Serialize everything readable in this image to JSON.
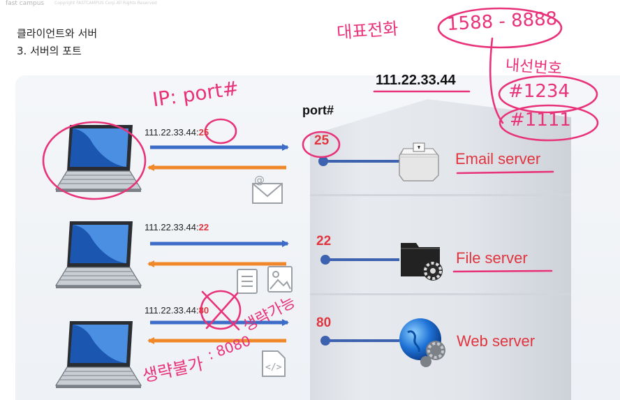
{
  "header": {
    "brand": "fast campus",
    "copyright": "Copyright FASTCAMPUS Corp All Rights Reserved",
    "title_line1": "클라이언트와 서버",
    "title_line2": "3. 서버의 포트"
  },
  "diagram": {
    "server_ip": "111.22.33.44",
    "port_header": "port#",
    "rows": [
      {
        "client_ip": "111.22.33.44:",
        "client_port": "25",
        "port": "25",
        "server": "Email server",
        "attachment_icons": [
          "email-icon"
        ]
      },
      {
        "client_ip": "111.22.33.44:",
        "client_port": "22",
        "port": "22",
        "server": "File server",
        "attachment_icons": [
          "document-icon",
          "image-icon"
        ]
      },
      {
        "client_ip": "111.22.33.44:",
        "client_port": "80",
        "port": "80",
        "server": "Web server",
        "attachment_icons": [
          "code-file-icon"
        ]
      }
    ],
    "colors": {
      "request_arrow": "#3c6cc8",
      "response_arrow": "#f0882a",
      "port_accent": "#e0353f",
      "server_line": "#3d63b0",
      "handwriting": "#e8327a"
    }
  },
  "annotations": {
    "ip_port_note": "IP: port#",
    "phone_label": "대표전화",
    "phone_number": "1588 - 8888",
    "extension_label": "내선번호",
    "extension_1": "#1234",
    "extension_2": "#1111",
    "omit_possible": "생략가능",
    "omit_impossible": "생략불가",
    "port_8080": ": 8080"
  }
}
